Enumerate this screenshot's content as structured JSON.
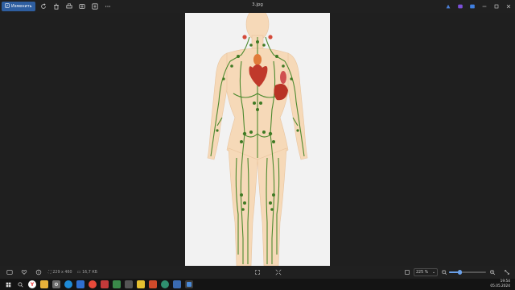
{
  "window": {
    "title": "3.jpg"
  },
  "toolbar": {
    "primary_button_label": "Изменить",
    "primary_icon": "edit-image-icon",
    "tools": [
      "rotate-icon",
      "delete-icon",
      "print-icon",
      "album-icon",
      "add-icon",
      "more-icon"
    ],
    "right_tools": [
      "copilot-icon",
      "clipchamp-icon",
      "share-icon",
      "minimize-icon",
      "maximize-icon",
      "close-icon"
    ]
  },
  "image": {
    "subject": "lymphatic-system-figure",
    "colors": {
      "skin": "#f6d9b8",
      "lymph": "#4d8a2f",
      "heart": "#c0392b",
      "liver": "#b83224",
      "bg": "#f2f2f2"
    }
  },
  "statusbar": {
    "dimensions": "229 x 460",
    "file_size": "16,7 КБ",
    "zoom_level": "225 %",
    "zoom_fraction": 0.3
  },
  "clock": {
    "time": "19:54",
    "date": "05.05.2024"
  },
  "taskbar": {
    "icons": [
      "start-icon",
      "search-icon",
      "yandex-icon",
      "files-icon",
      "settings-icon",
      "edge-icon",
      "store-icon",
      "chrome-icon",
      "pdf-icon",
      "photos-icon",
      "camera-icon",
      "notes-icon",
      "office-icon",
      "media-icon",
      "paint-icon",
      "photo-viewer-icon"
    ]
  }
}
